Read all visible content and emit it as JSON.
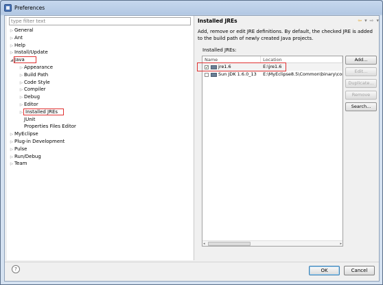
{
  "window": {
    "title": "Preferences"
  },
  "left": {
    "filter_placeholder": "type filter text",
    "tree": [
      {
        "label": "General",
        "level": 0,
        "arrow": "▷"
      },
      {
        "label": "Ant",
        "level": 0,
        "arrow": "▷"
      },
      {
        "label": "Help",
        "level": 0,
        "arrow": "▷"
      },
      {
        "label": "Install/Update",
        "level": 0,
        "arrow": "▷"
      },
      {
        "label": "Java",
        "level": 0,
        "arrow": "◢",
        "highlight": true
      },
      {
        "label": "Appearance",
        "level": 1,
        "arrow": "▷"
      },
      {
        "label": "Build Path",
        "level": 1,
        "arrow": "▷"
      },
      {
        "label": "Code Style",
        "level": 1,
        "arrow": "▷"
      },
      {
        "label": "Compiler",
        "level": 1,
        "arrow": "▷"
      },
      {
        "label": "Debug",
        "level": 1,
        "arrow": "▷"
      },
      {
        "label": "Editor",
        "level": 1,
        "arrow": "▷"
      },
      {
        "label": "Installed JREs",
        "level": 1,
        "arrow": "▷",
        "highlight": true
      },
      {
        "label": "JUnit",
        "level": 1,
        "arrow": ""
      },
      {
        "label": "Properties Files Editor",
        "level": 1,
        "arrow": ""
      },
      {
        "label": "MyEclipse",
        "level": 0,
        "arrow": "▷"
      },
      {
        "label": "Plug-in Development",
        "level": 0,
        "arrow": "▷"
      },
      {
        "label": "Pulse",
        "level": 0,
        "arrow": "▷"
      },
      {
        "label": "Run/Debug",
        "level": 0,
        "arrow": "▷"
      },
      {
        "label": "Team",
        "level": 0,
        "arrow": "▷"
      }
    ]
  },
  "right": {
    "title": "Installed JREs",
    "nav": {
      "back": "⇦",
      "back_menu": "▾",
      "forward": "⇨",
      "forward_menu": "▾"
    },
    "description": "Add, remove or edit JRE definitions. By default, the checked JRE is added to the build path of newly created Java projects.",
    "jres_label": "Installed JREs:",
    "table": {
      "headers": {
        "name": "Name",
        "location": "Location"
      },
      "rows": [
        {
          "checked": true,
          "name": "jre1.6",
          "location": "E:\\jre1.6"
        },
        {
          "checked": false,
          "name": "Sun JDK 1.6.0_13",
          "location": "E:\\MyEclipse8.5\\Common\\binary\\com"
        }
      ],
      "scroll": {
        "left": "◂",
        "right": "▸"
      }
    },
    "buttons": {
      "add": "Add...",
      "edit": "Edit...",
      "duplicate": "Duplicate...",
      "remove": "Remove",
      "search": "Search..."
    }
  },
  "footer": {
    "help": "?",
    "ok": "OK",
    "cancel": "Cancel"
  }
}
